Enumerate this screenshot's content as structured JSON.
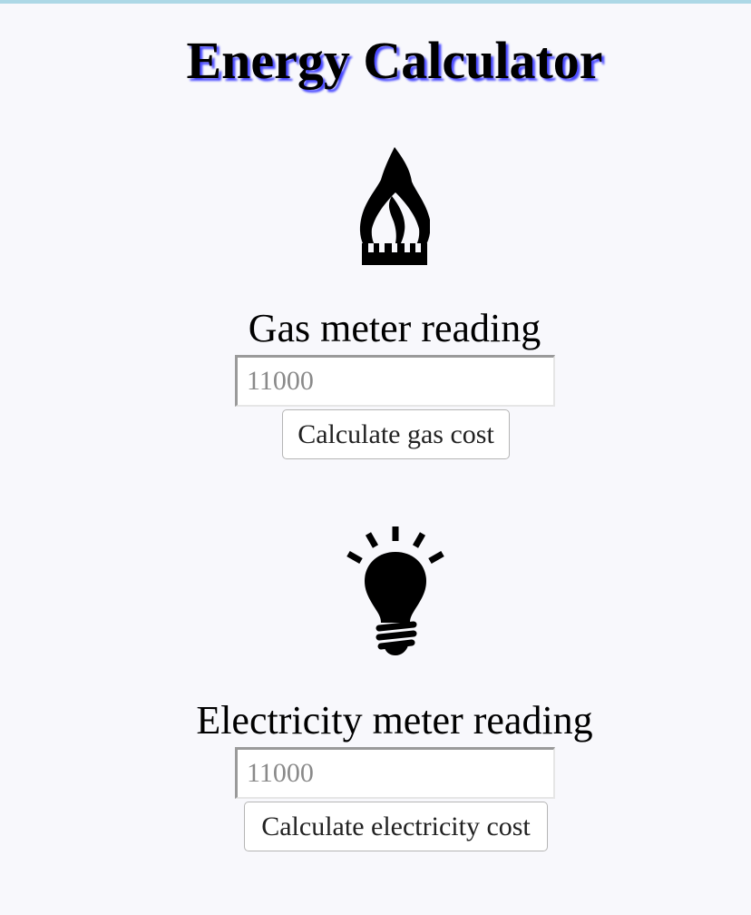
{
  "page": {
    "title": "Energy Calculator",
    "accent_border_color": "#add8e6",
    "title_shadow_color": "#4a4aff"
  },
  "gas": {
    "icon": "flame-icon",
    "label": "Gas meter reading",
    "input_placeholder": "11000",
    "input_value": "",
    "button_label": "Calculate gas cost"
  },
  "electricity": {
    "icon": "lightbulb-icon",
    "label": "Electricity meter reading",
    "input_placeholder": "11000",
    "input_value": "",
    "button_label": "Calculate electricity cost"
  }
}
